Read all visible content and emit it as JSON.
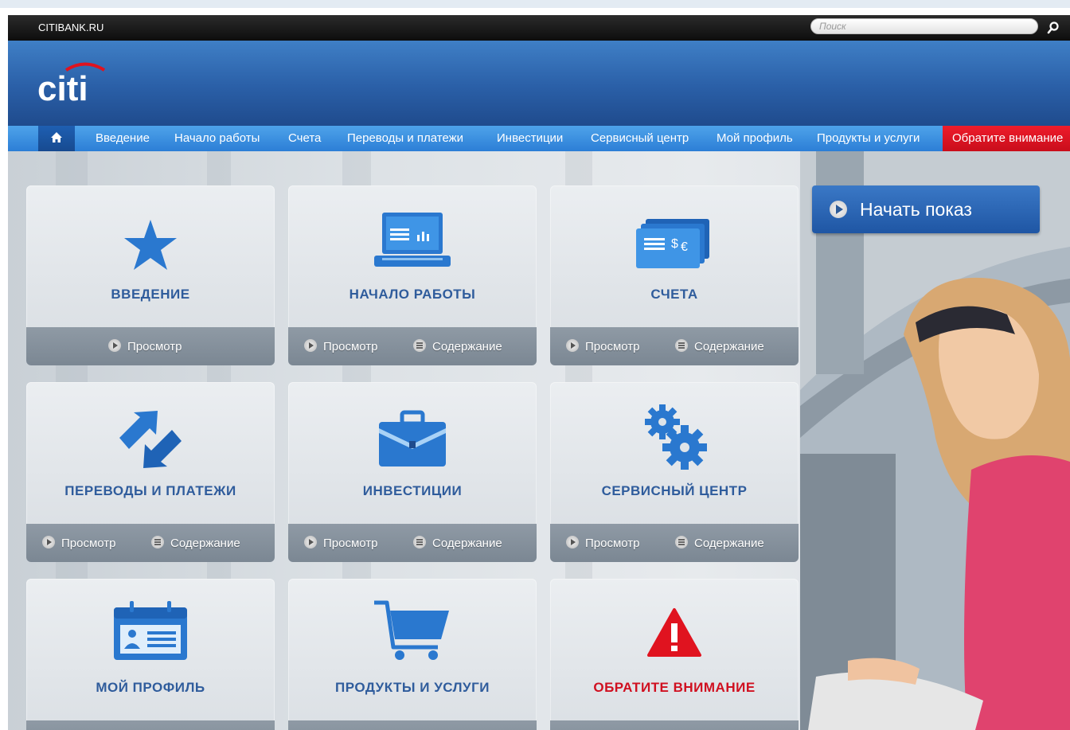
{
  "topbar": {
    "site_name": "CITIBANK.RU",
    "search_placeholder": "Поиск"
  },
  "header": {
    "logo_text": "citi"
  },
  "nav": {
    "items": [
      {
        "label": "Введение"
      },
      {
        "label": "Начало работы"
      },
      {
        "label": "Счета"
      },
      {
        "label": "Переводы и платежи"
      },
      {
        "label": "Инвестиции"
      },
      {
        "label": "Сервисный центр"
      },
      {
        "label": "Мой профиль"
      },
      {
        "label": "Продукты и услуги"
      }
    ],
    "alert_label": "Обратите внимание"
  },
  "tiles": [
    {
      "title": "ВВЕДЕНИЕ",
      "icon": "star-icon",
      "view": "Просмотр"
    },
    {
      "title": "НАЧАЛО РАБОТЫ",
      "icon": "laptop-icon",
      "view": "Просмотр",
      "contents": "Содержание"
    },
    {
      "title": "СЧЕТА",
      "icon": "accounts-icon",
      "view": "Просмотр",
      "contents": "Содержание"
    },
    {
      "title": "ПЕРЕВОДЫ И ПЛАТЕЖИ",
      "icon": "transfer-arrows-icon",
      "view": "Просмотр",
      "contents": "Содержание"
    },
    {
      "title": "ИНВЕСТИЦИИ",
      "icon": "briefcase-icon",
      "view": "Просмотр",
      "contents": "Содержание"
    },
    {
      "title": "СЕРВИСНЫЙ ЦЕНТР",
      "icon": "gears-icon",
      "view": "Просмотр",
      "contents": "Содержание"
    },
    {
      "title": "МОЙ ПРОФИЛЬ",
      "icon": "profile-card-icon"
    },
    {
      "title": "ПРОДУКТЫ И УСЛУГИ",
      "icon": "shopping-cart-icon"
    },
    {
      "title": "ОБРАТИТЕ ВНИМАНИЕ",
      "icon": "warning-icon"
    }
  ],
  "start_show": {
    "label": "Начать показ"
  },
  "colors": {
    "brand_blue": "#2a5fa7",
    "nav_blue": "#3a8fe0",
    "alert_red": "#e0131f",
    "tile_title_blue": "#2f5c9c"
  }
}
